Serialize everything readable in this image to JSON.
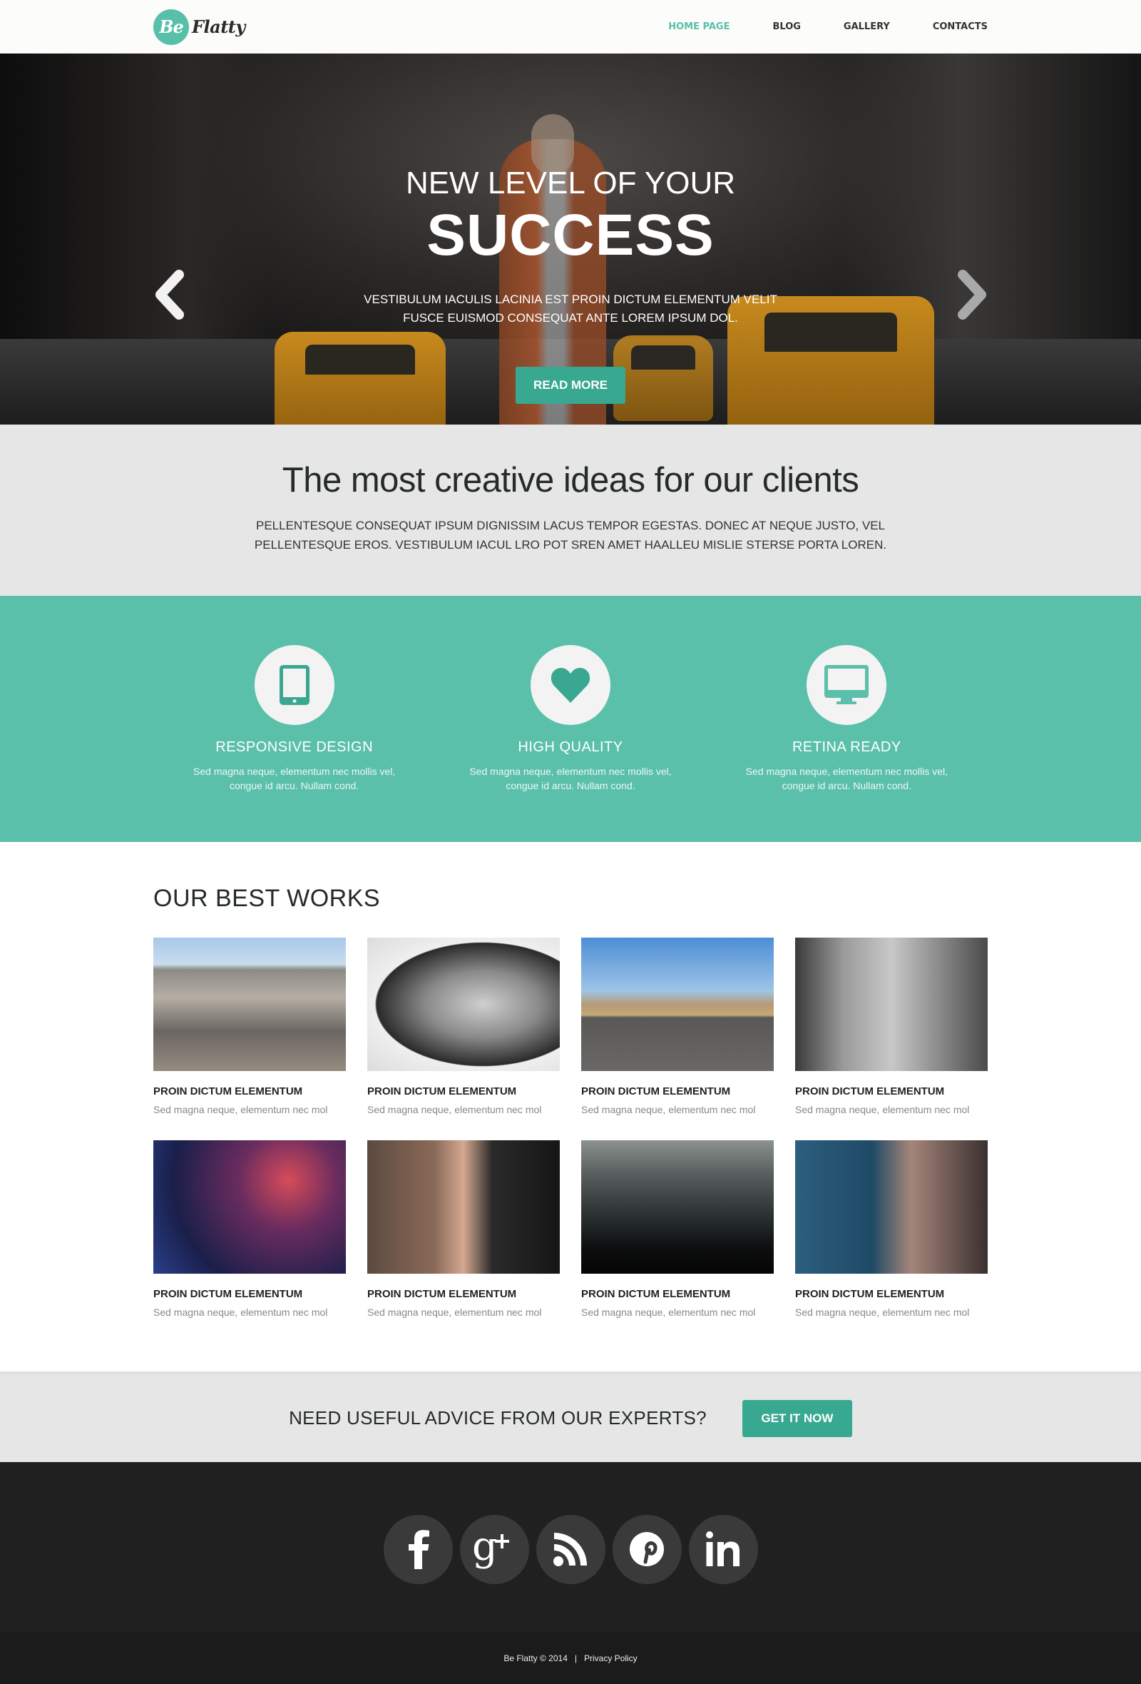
{
  "brand": {
    "logo_mark": "Be",
    "logo_text": "Flatty",
    "accent": "#58bfa9",
    "button_color": "#39a890"
  },
  "nav": {
    "items": [
      {
        "label": "HOME PAGE",
        "active": true
      },
      {
        "label": "BLOG",
        "active": false
      },
      {
        "label": "GALLERY",
        "active": false
      },
      {
        "label": "CONTACTS",
        "active": false
      }
    ]
  },
  "hero": {
    "line1": "NEW LEVEL OF YOUR",
    "line2": "SUCCESS",
    "description": "VESTIBULUM IACULIS LACINIA EST PROIN DICTUM ELEMENTUM VELIT FUSCE EUISMOD CONSEQUAT ANTE LOREM IPSUM DOL.",
    "button_label": "READ MORE",
    "prev_icon": "chevron-left-icon",
    "next_icon": "chevron-right-icon"
  },
  "intro": {
    "title": "The most creative ideas for our clients",
    "text": "PELLENTESQUE CONSEQUAT IPSUM DIGNISSIM LACUS TEMPOR EGESTAS. DONEC AT NEQUE JUSTO, VEL PELLENTESQUE EROS. VESTIBULUM IACUL LRO POT SREN AMET HAALLEU MISLIE STERSE PORTA LOREN."
  },
  "features": [
    {
      "icon": "tablet-icon",
      "title": "RESPONSIVE DESIGN",
      "text": "Sed magna neque, elementum nec mollis vel, congue id arcu. Nullam cond."
    },
    {
      "icon": "heart-icon",
      "title": "HIGH QUALITY",
      "text": "Sed magna neque, elementum nec mollis vel, congue id arcu. Nullam cond."
    },
    {
      "icon": "monitor-icon",
      "title": "RETINA READY",
      "text": "Sed magna neque, elementum nec mollis vel, congue id arcu. Nullam cond."
    }
  ],
  "works": {
    "heading": "OUR BEST WORKS",
    "items": [
      {
        "image": "city-aerial",
        "title": "PROIN DICTUM ELEMENTUM",
        "text": "Sed magna neque, elementum nec mol"
      },
      {
        "image": "man-portrait",
        "title": "PROIN DICTUM ELEMENTUM",
        "text": "Sed magna neque, elementum nec mol"
      },
      {
        "image": "desert-road-car",
        "title": "PROIN DICTUM ELEMENTUM",
        "text": "Sed magna neque, elementum nec mol"
      },
      {
        "image": "shopping-woman",
        "title": "PROIN DICTUM ELEMENTUM",
        "text": "Sed magna neque, elementum nec mol"
      },
      {
        "image": "party-couple",
        "title": "PROIN DICTUM ELEMENTUM",
        "text": "Sed magna neque, elementum nec mol"
      },
      {
        "image": "romantic-couple",
        "title": "PROIN DICTUM ELEMENTUM",
        "text": "Sed magna neque, elementum nec mol"
      },
      {
        "image": "night-city",
        "title": "PROIN DICTUM ELEMENTUM",
        "text": "Sed magna neque, elementum nec mol"
      },
      {
        "image": "woman-hair",
        "title": "PROIN DICTUM ELEMENTUM",
        "text": "Sed magna neque, elementum nec mol"
      }
    ]
  },
  "cta": {
    "text": "NEED USEFUL ADVICE FROM OUR EXPERTS?",
    "button_label": "GET IT NOW"
  },
  "social": [
    "facebook-icon",
    "google-plus-icon",
    "rss-icon",
    "pinterest-icon",
    "linkedin-icon"
  ],
  "footer": {
    "copyright": "Be Flatty © 2014",
    "separator": "|",
    "privacy_label": "Privacy Policy"
  }
}
